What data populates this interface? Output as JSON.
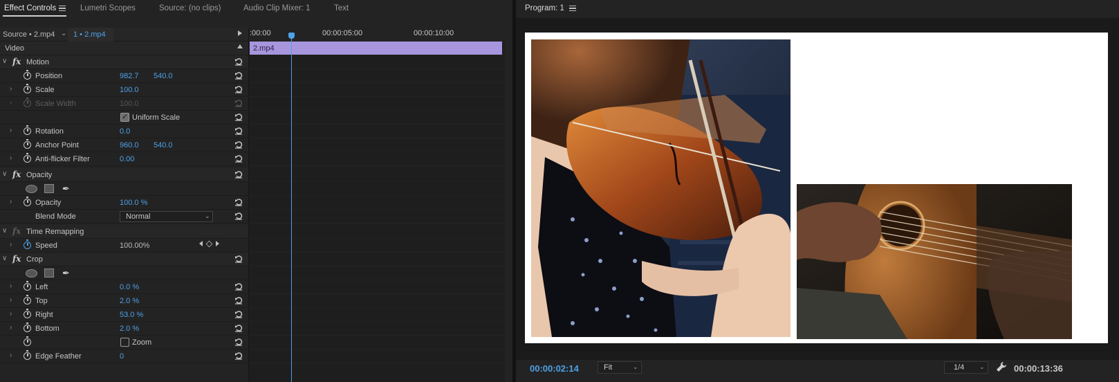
{
  "left_tabs": {
    "effect_controls": "Effect Controls",
    "lumetri_scopes": "Lumetri Scopes",
    "source": "Source: (no clips)",
    "audio_clip_mixer": "Audio Clip Mixer: 1",
    "text": "Text"
  },
  "source_bar": {
    "source": "Source • 2.mp4",
    "clip": "1 • 2.mp4"
  },
  "video_header": "Video",
  "effects": {
    "motion": "Motion",
    "position": {
      "label": "Position",
      "x": "982.7",
      "y": "540.0"
    },
    "scale": {
      "label": "Scale",
      "value": "100.0"
    },
    "scale_width": {
      "label": "Scale Width",
      "value": "100.0"
    },
    "uniform_scale": "Uniform Scale",
    "rotation": {
      "label": "Rotation",
      "value": "0.0"
    },
    "anchor_point": {
      "label": "Anchor Point",
      "x": "960.0",
      "y": "540.0"
    },
    "anti_flicker": {
      "label": "Anti-flicker Filter",
      "value": "0.00"
    },
    "opacity_section": "Opacity",
    "opacity": {
      "label": "Opacity",
      "value": "100.0 %"
    },
    "blend_mode": {
      "label": "Blend Mode",
      "value": "Normal"
    },
    "time_remapping": "Time Remapping",
    "speed": {
      "label": "Speed",
      "value": "100.00%"
    },
    "crop": "Crop",
    "left": {
      "label": "Left",
      "value": "0.0 %"
    },
    "top": {
      "label": "Top",
      "value": "2.0 %"
    },
    "right": {
      "label": "Right",
      "value": "53.0 %"
    },
    "bottom": {
      "label": "Bottom",
      "value": "2.0 %"
    },
    "zoom": "Zoom",
    "edge_feather": {
      "label": "Edge Feather",
      "value": "0"
    }
  },
  "timeline": {
    "ticks": [
      ":00:00",
      "00:00:05:00",
      "00:00:10:00"
    ],
    "clip_name": "2.mp4"
  },
  "program": {
    "title": "Program: 1",
    "current_time": "00:00:02:14",
    "fit": "Fit",
    "resolution": "1/4",
    "duration": "00:00:13:36"
  },
  "colors": {
    "accent_blue": "#4ea1e6",
    "clip_purple": "#a795dd",
    "panel_bg": "#232323"
  }
}
